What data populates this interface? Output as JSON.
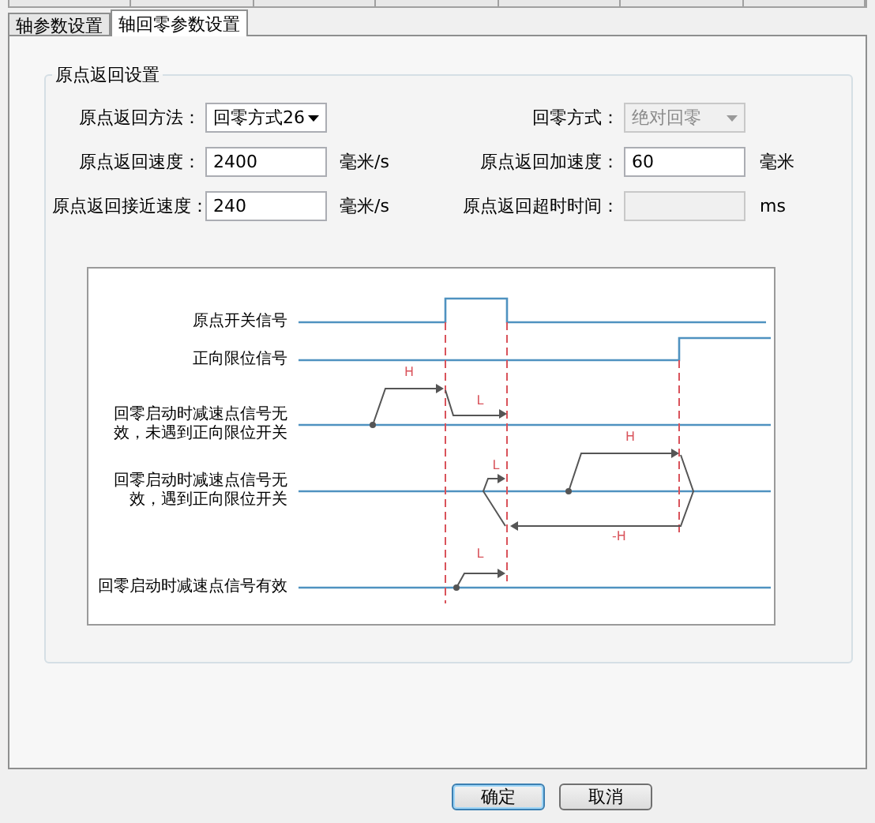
{
  "tabs": [
    {
      "label": "轴参数设置",
      "selected": false
    },
    {
      "label": "轴回零参数设置",
      "selected": true
    }
  ],
  "group": {
    "title": "原点返回设置",
    "rows": [
      [
        {
          "kind": "dropdown",
          "label": "原点返回方法：",
          "value": "回零方式26",
          "disabled": false
        },
        {
          "kind": "dropdown",
          "label": "回零方式：",
          "value": "绝对回零",
          "disabled": true
        }
      ],
      [
        {
          "kind": "input",
          "label": "原点返回速度：",
          "value": "2400",
          "unit": "毫米/s",
          "disabled": false
        },
        {
          "kind": "input",
          "label": "原点返回加速度：",
          "value": "60",
          "unit": "毫米",
          "disabled": false
        }
      ],
      [
        {
          "kind": "input",
          "label": "原点返回接近速度：",
          "value": "240",
          "unit": "毫米/s",
          "disabled": false
        },
        {
          "kind": "input",
          "label": "原点返回超时时间：",
          "unit": "ms",
          "disabled": true
        }
      ]
    ],
    "diagram": {
      "signals": [
        {
          "label": "原点开关信号",
          "kind": "single"
        },
        {
          "label": "正向限位信号",
          "kind": "single"
        },
        {
          "label": "回零启动时减速点信号无效，未遇到正向限位开关",
          "kind": "wrapped"
        },
        {
          "label": "回零启动时减速点信号无效，遇到正向限位开关",
          "kind": "wrapped"
        },
        {
          "label": "回零启动时减速点信号有效",
          "kind": "single"
        }
      ],
      "arrow_labels": [
        "H",
        "L",
        "H",
        "-H",
        "L",
        "L"
      ]
    }
  },
  "buttons": [
    {
      "label": "确定",
      "default": true
    },
    {
      "label": "取消",
      "default": false
    }
  ]
}
